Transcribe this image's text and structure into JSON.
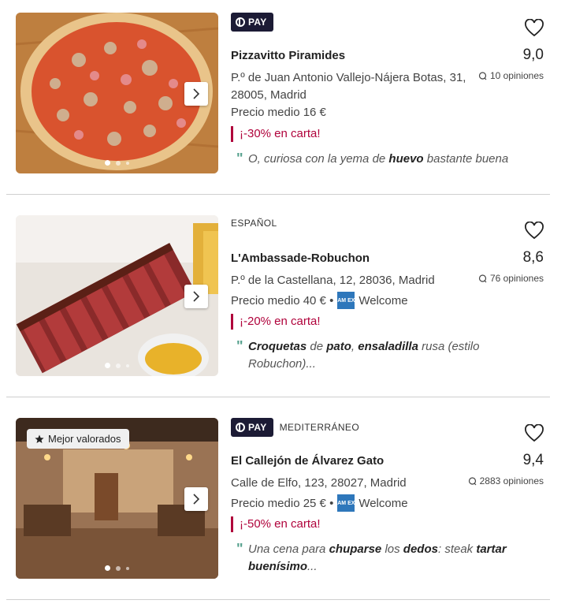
{
  "restaurants": [
    {
      "pay_label": "PAY",
      "cuisine": "",
      "name": "Pizzavitto Piramides",
      "rating": "9,0",
      "reviews": "10 opiniones",
      "address": "P.º de Juan Antonio Vallejo-Nájera Botas, 31, 28005, Madrid",
      "price": "Precio medio 16 €",
      "payment": "",
      "promo": "¡-30% en carta!",
      "review_parts": [
        {
          "t": "O, curiosa con la yema de ",
          "b": false
        },
        {
          "t": "huevo",
          "b": true
        },
        {
          "t": " bastante buena",
          "b": false
        }
      ],
      "badge": "",
      "image": "pizza-photo"
    },
    {
      "pay_label": "",
      "cuisine": "ESPAÑOL",
      "name": "L'Ambassade-Robuchon",
      "rating": "8,6",
      "reviews": "76 opiniones",
      "address": "P.º de la Castellana, 12, 28036, Madrid",
      "price": "Precio medio 40 € •",
      "payment": "Welcome",
      "promo": "¡-20% en carta!",
      "review_parts": [
        {
          "t": "Croquetas",
          "b": true
        },
        {
          "t": " de ",
          "b": false
        },
        {
          "t": "pato",
          "b": true
        },
        {
          "t": ", ",
          "b": false
        },
        {
          "t": "ensaladilla",
          "b": true
        },
        {
          "t": " rusa (estilo Robuchon)...",
          "b": false
        }
      ],
      "badge": "",
      "image": "steak-photo"
    },
    {
      "pay_label": "PAY",
      "cuisine": "MEDITERRÁNEO",
      "name": "El Callejón de Álvarez Gato",
      "rating": "9,4",
      "reviews": "2883 opiniones",
      "address": "Calle de Elfo, 123, 28027, Madrid",
      "price": "Precio medio 25 € •",
      "payment": "Welcome",
      "promo": "¡-50% en carta!",
      "review_parts": [
        {
          "t": "Una cena para ",
          "b": false
        },
        {
          "t": "chuparse",
          "b": true
        },
        {
          "t": " los ",
          "b": false
        },
        {
          "t": "dedos",
          "b": true
        },
        {
          "t": ": steak ",
          "b": false
        },
        {
          "t": "tartar buenísimo",
          "b": true
        },
        {
          "t": "...",
          "b": false
        }
      ],
      "badge": "Mejor valorados",
      "image": "dining-room-photo"
    }
  ],
  "amex_label": "AM EX",
  "colors": {
    "promo": "#b0023b",
    "pay_bg": "#1c1b35",
    "quote": "#58a28f",
    "amex": "#2e77bb"
  }
}
